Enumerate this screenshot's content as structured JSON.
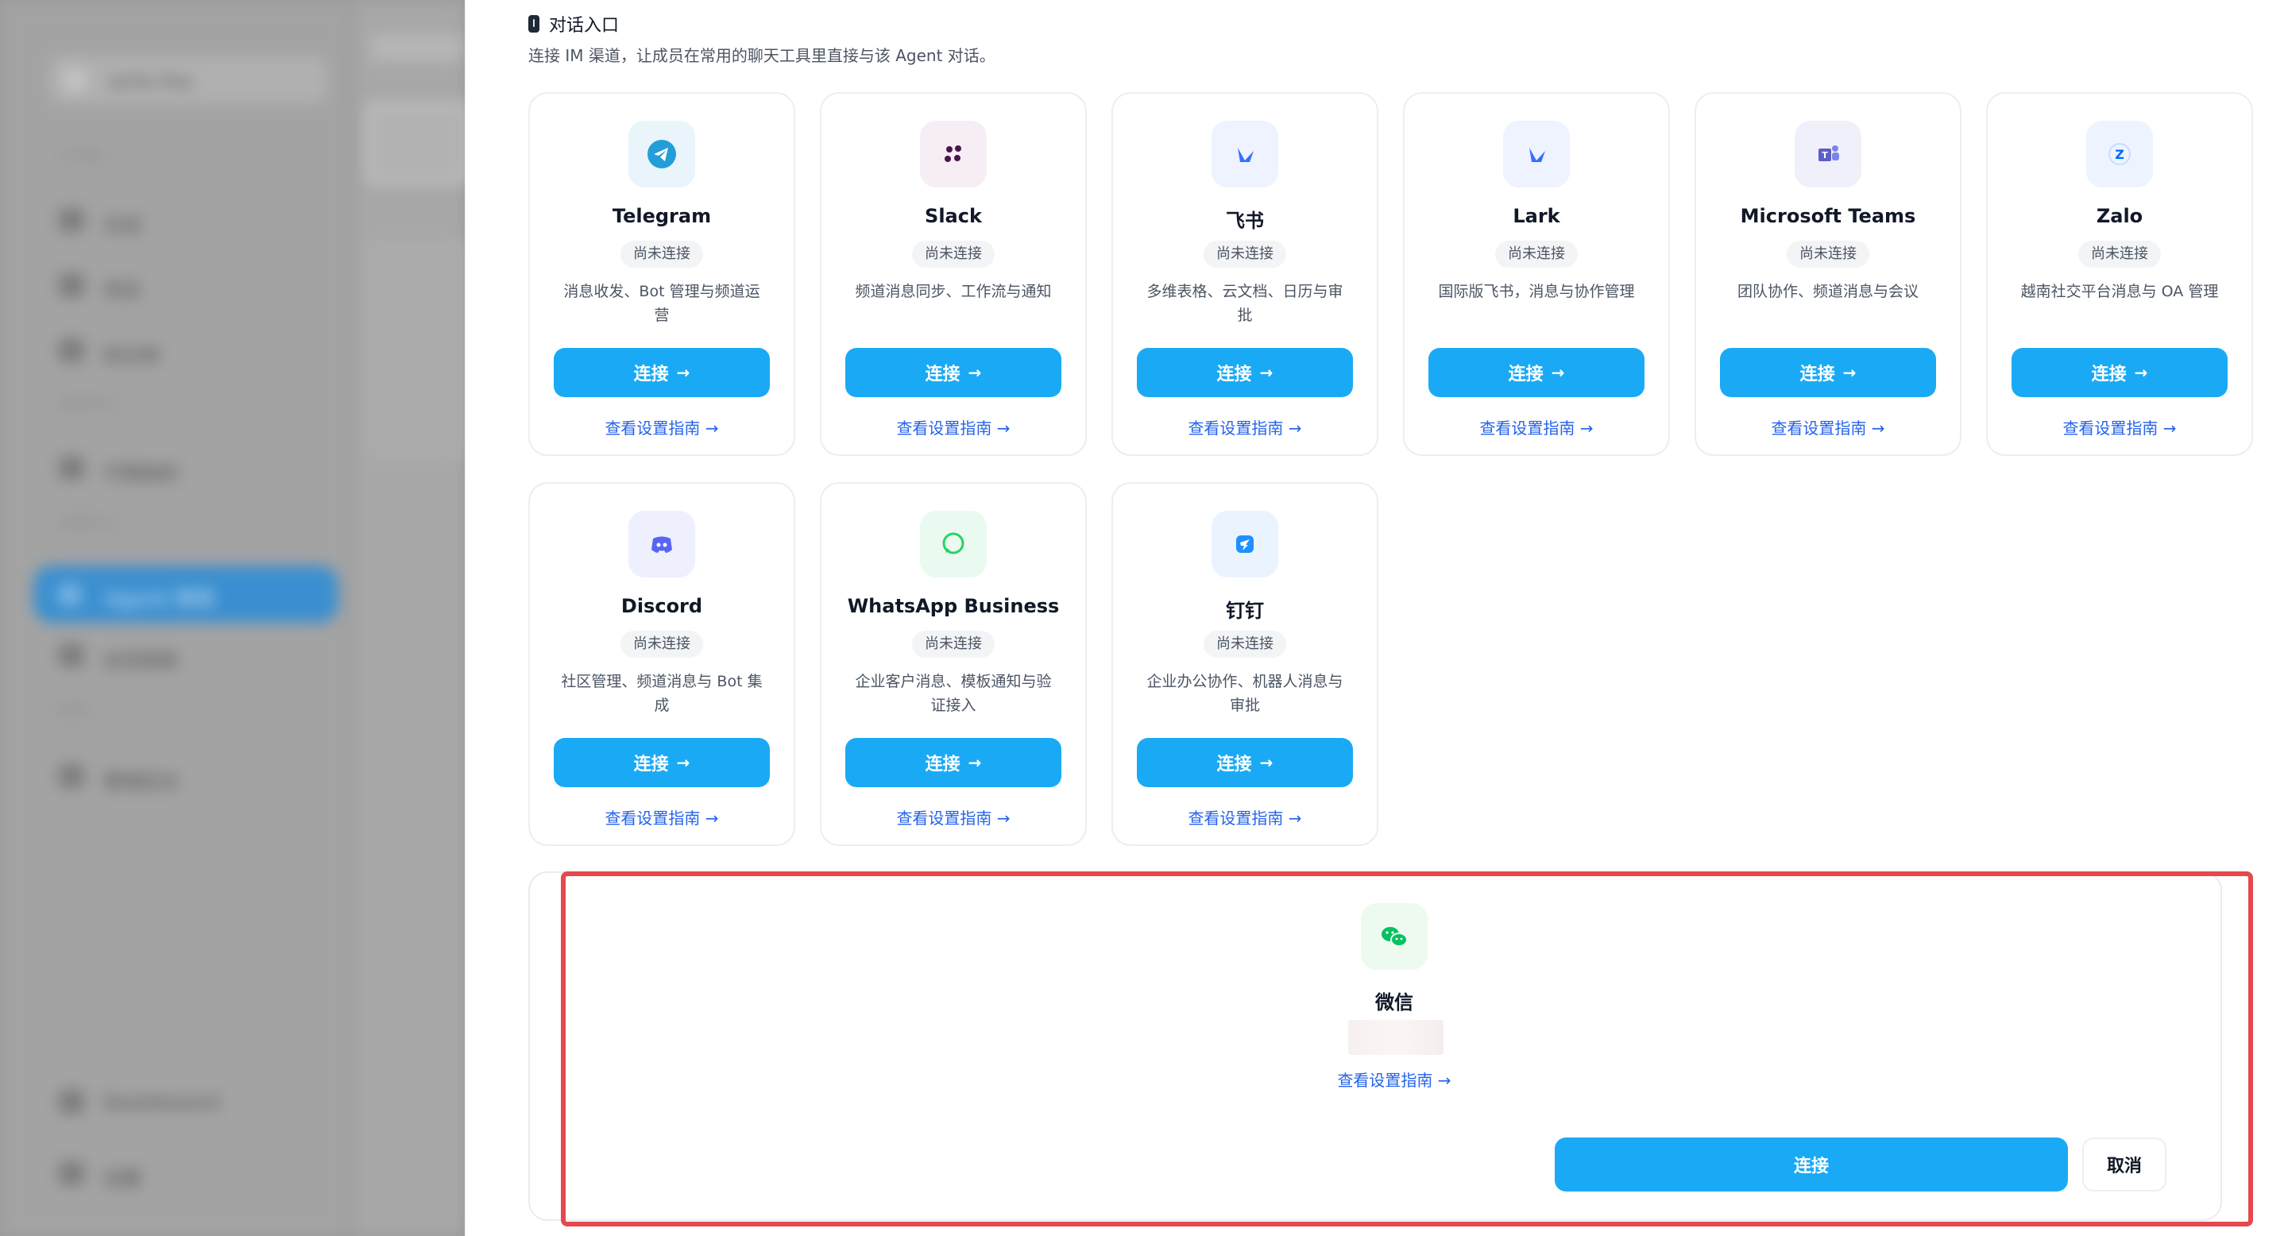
{
  "background_app": {
    "workspace": "arts-ha",
    "sidebar_captions": [
      "工作区",
      "资源中心",
      "设置",
      "财务"
    ],
    "sidebar_items": [
      "对话",
      "项目",
      "知识库",
      "代理组织",
      "Agent 管理",
      "应用更新",
      "管理后台",
      "Dashboard",
      "设置"
    ]
  },
  "section": {
    "title": "对话入口",
    "description": "连接 IM 渠道，让成员在常用的聊天工具里直接与该 Agent 对话。"
  },
  "common": {
    "status_not_connected": "尚未连接",
    "connect_label": "连接",
    "guide_label": "查看设置指南",
    "arrow": "→"
  },
  "channels": [
    {
      "name": "Telegram",
      "description": "消息收发、Bot 管理与频道运营",
      "icon": "telegram-icon",
      "color": "#229ED9"
    },
    {
      "name": "Slack",
      "description": "频道消息同步、工作流与通知",
      "icon": "slack-icon",
      "color": "#4A154B"
    },
    {
      "name": "飞书",
      "description": "多维表格、云文档、日历与审批",
      "icon": "feishu-icon",
      "color": "#3370FF"
    },
    {
      "name": "Lark",
      "description": "国际版飞书，消息与协作管理",
      "icon": "lark-icon",
      "color": "#3370FF"
    },
    {
      "name": "Microsoft Teams",
      "description": "团队协作、频道消息与会议",
      "icon": "teams-icon",
      "color": "#5B5FC7"
    },
    {
      "name": "Zalo",
      "description": "越南社交平台消息与 OA 管理",
      "icon": "zalo-icon",
      "color": "#0068FF"
    },
    {
      "name": "Discord",
      "description": "社区管理、频道消息与 Bot 集成",
      "icon": "discord-icon",
      "color": "#5865F2"
    },
    {
      "name": "WhatsApp Business",
      "description": "企业客户消息、模板通知与验证接入",
      "icon": "whatsapp-icon",
      "color": "#25D366"
    },
    {
      "name": "钉钉",
      "description": "企业办公协作、机器人消息与审批",
      "icon": "dingtalk-icon",
      "color": "#1E90FF"
    }
  ],
  "wechat": {
    "name": "微信",
    "guide_label": "查看设置指南",
    "connect_label": "连接",
    "cancel_label": "取消",
    "icon": "wechat-icon",
    "color": "#07C160"
  },
  "colors": {
    "primary_button": "#1AAAF5",
    "link": "#2563EB",
    "highlight": "#E5484D"
  }
}
